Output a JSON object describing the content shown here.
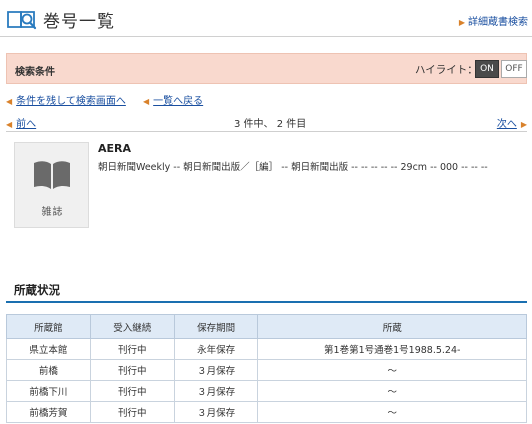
{
  "header": {
    "title": "巻号一覧",
    "detail_link": "詳細蔵書検索"
  },
  "search_conditions": {
    "label": "検索条件",
    "highlight_label": "ハイライト：",
    "on_label": "ON",
    "off_label": "OFF"
  },
  "nav": {
    "back_to_search": "条件を残して検索画面へ",
    "back_to_list": "一覧へ戻る"
  },
  "pager": {
    "prev_label": "前へ",
    "count_text": "3 件中、 2 件目",
    "next_label": "次へ"
  },
  "record": {
    "type_label": "雑誌",
    "title": "AERA",
    "meta": "朝日新聞Weekly -- 朝日新聞出版／［編］ -- 朝日新聞出版 -- -- -- -- -- 29cm -- 000 -- -- --"
  },
  "holdings": {
    "title": "所蔵状況",
    "columns": [
      "所蔵館",
      "受入継続",
      "保存期間",
      "所蔵"
    ],
    "rows": [
      [
        "県立本館",
        "刊行中",
        "永年保存",
        "第1巻第1号通巻1号1988.5.24-"
      ],
      [
        "前橋",
        "刊行中",
        "３月保存",
        "～"
      ],
      [
        "前橋下川",
        "刊行中",
        "３月保存",
        "～"
      ],
      [
        "前橋芳賀",
        "刊行中",
        "３月保存",
        "～"
      ]
    ]
  },
  "colors": {
    "accent_blue": "#1a6fb0",
    "link_blue": "#1a4fa0",
    "condition_bar": "#f9d9ce",
    "table_header": "#dfeaf6",
    "arrow_orange": "#d9822b"
  }
}
